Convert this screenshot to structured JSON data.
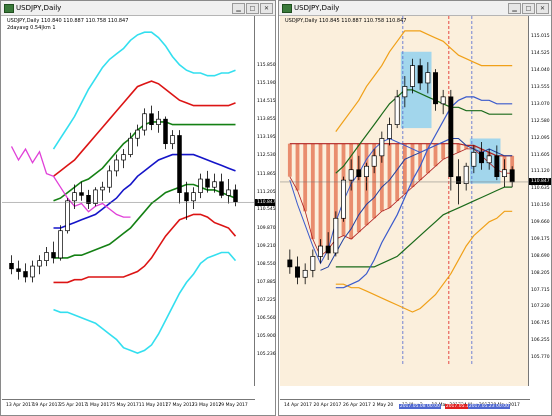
{
  "colors": {
    "candle": "#000000",
    "bb_outer": "#33dfef",
    "bb_mid": "#dc1414",
    "bb_inner": "#148014",
    "bb_center": "#1414c8",
    "rci": "#e040d8",
    "right_bg": "#fbefdc",
    "ichimoku_cloud": "#e26440",
    "ichimoku_base": "#1a6a1a",
    "ichimoku_conv": "#3a5acc",
    "orange_band": "#f0a018",
    "highlight_box": "#8ccff0",
    "vline_blue": "#5068d0",
    "vline_red": "#e02020",
    "price_marker": "#000000"
  },
  "left_chart": {
    "title": "USDJPY,Daily",
    "info_line1": "USDJPY,Daily  110.840 110.887 110.758 110.847",
    "info_line2": "2dayavg 0.54|km 1",
    "price_labels": [
      "115.850",
      "115.190",
      "114.515",
      "113.855",
      "113.195",
      "112.530",
      "111.865",
      "111.205",
      "110.545",
      "109.870",
      "109.210",
      "108.550",
      "107.885",
      "107.225",
      "106.560",
      "105.900",
      "105.236"
    ],
    "current_price": "110.847",
    "time_labels": [
      "13 Apr 2017",
      "19 Apr 2017",
      "25 Apr 2017",
      "1 May 2017",
      "5 May 2017",
      "11 May 2017",
      "17 May 2017",
      "23 May 2017",
      "29 May 2017"
    ],
    "candles": [
      [
        108.6,
        108.9,
        108.2,
        108.4
      ],
      [
        108.4,
        108.7,
        108.0,
        108.3
      ],
      [
        108.3,
        108.6,
        107.9,
        108.1
      ],
      [
        108.1,
        108.7,
        107.9,
        108.5
      ],
      [
        108.5,
        108.9,
        108.2,
        108.7
      ],
      [
        108.7,
        109.2,
        108.5,
        109.0
      ],
      [
        109.0,
        109.4,
        108.6,
        108.8
      ],
      [
        108.8,
        110.0,
        108.7,
        109.8
      ],
      [
        109.8,
        111.0,
        109.7,
        110.9
      ],
      [
        110.9,
        111.5,
        110.6,
        111.2
      ],
      [
        111.2,
        111.6,
        110.9,
        111.1
      ],
      [
        111.1,
        111.3,
        110.6,
        110.8
      ],
      [
        110.8,
        111.4,
        110.7,
        111.3
      ],
      [
        111.3,
        111.6,
        110.9,
        111.4
      ],
      [
        111.4,
        112.2,
        111.2,
        112.0
      ],
      [
        112.0,
        112.6,
        111.8,
        112.4
      ],
      [
        112.4,
        112.8,
        112.1,
        112.6
      ],
      [
        112.6,
        113.4,
        112.5,
        113.2
      ],
      [
        113.2,
        113.7,
        112.9,
        113.5
      ],
      [
        113.5,
        114.3,
        113.3,
        114.1
      ],
      [
        114.1,
        114.4,
        113.5,
        113.7
      ],
      [
        113.7,
        114.2,
        113.4,
        113.9
      ],
      [
        113.9,
        114.0,
        112.8,
        113.0
      ],
      [
        113.0,
        113.5,
        112.8,
        113.3
      ],
      [
        113.3,
        113.5,
        110.8,
        111.2
      ],
      [
        111.2,
        111.6,
        110.2,
        110.9
      ],
      [
        110.9,
        111.4,
        110.6,
        111.2
      ],
      [
        111.2,
        111.9,
        111.0,
        111.7
      ],
      [
        111.7,
        112.0,
        111.2,
        111.4
      ],
      [
        111.4,
        111.9,
        111.2,
        111.6
      ],
      [
        111.6,
        111.9,
        111.0,
        111.1
      ],
      [
        111.1,
        111.7,
        110.8,
        111.3
      ],
      [
        111.3,
        111.5,
        110.7,
        110.85
      ]
    ],
    "bb_upper3": [
      null,
      null,
      null,
      null,
      null,
      null,
      112.8,
      113.2,
      113.6,
      114.0,
      114.5,
      115.0,
      115.4,
      115.8,
      116.1,
      116.3,
      116.5,
      116.8,
      117.0,
      117.1,
      117.1,
      116.9,
      116.6,
      116.2,
      115.9,
      115.7,
      115.6,
      115.6,
      115.5,
      115.5,
      115.6,
      115.6,
      115.7
    ],
    "bb_upper2": [
      null,
      null,
      null,
      null,
      null,
      null,
      111.8,
      112.0,
      112.2,
      112.4,
      112.7,
      113.0,
      113.3,
      113.6,
      113.9,
      114.2,
      114.5,
      114.8,
      115.1,
      115.2,
      115.3,
      115.2,
      115.0,
      114.8,
      114.6,
      114.5,
      114.4,
      114.4,
      114.4,
      114.4,
      114.4,
      114.4,
      114.5
    ],
    "bb_upper1": [
      null,
      null,
      null,
      null,
      null,
      null,
      110.9,
      111.0,
      111.2,
      111.4,
      111.6,
      111.7,
      111.9,
      112.1,
      112.4,
      112.7,
      113.0,
      113.2,
      113.5,
      113.7,
      113.8,
      113.8,
      113.8,
      113.7,
      113.7,
      113.7,
      113.7,
      113.7,
      113.7,
      113.7,
      113.7,
      113.7,
      113.7
    ],
    "bb_mid": [
      null,
      null,
      null,
      null,
      null,
      null,
      109.9,
      109.9,
      110.0,
      110.1,
      110.2,
      110.3,
      110.4,
      110.6,
      110.8,
      111.0,
      111.3,
      111.5,
      111.8,
      112.0,
      112.2,
      112.4,
      112.5,
      112.6,
      112.6,
      112.6,
      112.6,
      112.5,
      112.4,
      112.3,
      112.2,
      112.1,
      112.0
    ],
    "bb_lower1": [
      null,
      null,
      null,
      null,
      null,
      null,
      108.8,
      108.8,
      108.8,
      108.9,
      108.9,
      109.0,
      109.1,
      109.2,
      109.3,
      109.5,
      109.7,
      109.9,
      110.2,
      110.5,
      110.8,
      111.0,
      111.2,
      111.3,
      111.4,
      111.5,
      111.5,
      111.4,
      111.3,
      111.3,
      111.2,
      111.1,
      111.0
    ],
    "bb_lower2": [
      null,
      null,
      null,
      null,
      null,
      null,
      107.9,
      107.9,
      107.9,
      108.0,
      108.0,
      108.1,
      108.1,
      108.1,
      108.1,
      108.1,
      108.1,
      108.2,
      108.3,
      108.5,
      108.8,
      109.2,
      109.6,
      109.9,
      110.2,
      110.3,
      110.4,
      110.4,
      110.3,
      110.1,
      110.0,
      109.9,
      109.6
    ],
    "bb_lower3": [
      null,
      null,
      null,
      null,
      null,
      null,
      106.9,
      106.8,
      106.8,
      106.7,
      106.6,
      106.5,
      106.4,
      106.2,
      106.0,
      105.8,
      105.5,
      105.4,
      105.3,
      105.4,
      105.6,
      106.0,
      106.5,
      107.0,
      107.5,
      107.9,
      108.2,
      108.6,
      108.8,
      108.9,
      109.0,
      109.0,
      108.7
    ],
    "rci": [
      112.9,
      112.4,
      112.8,
      112.3,
      112.7,
      111.9,
      111.8,
      111.4,
      111.0,
      110.7,
      110.8,
      110.5,
      110.7,
      110.8,
      110.6,
      110.4,
      110.3,
      110.3,
      null,
      null,
      null,
      null,
      null,
      null,
      null,
      null,
      null,
      null,
      null,
      null,
      null,
      null,
      null
    ]
  },
  "right_chart": {
    "title": "USDJPY,Daily",
    "info_line1": "USDJPY,Daily  110.845 110.887 110.758 110.847",
    "price_labels": [
      "115.015",
      "114.525",
      "114.040",
      "113.555",
      "113.070",
      "112.580",
      "112.095",
      "111.605",
      "111.120",
      "110.635",
      "110.150",
      "109.660",
      "109.175",
      "108.690",
      "108.205",
      "107.715",
      "107.230",
      "106.745",
      "106.255",
      "105.770"
    ],
    "current_price": "110.847",
    "time_labels": [
      "14 Apr 2017",
      "20 Apr 2017",
      "26 Apr 2017",
      "2 May 20",
      "12 May 2",
      "18 May 2017",
      "24 May 2017",
      "30 May 2017"
    ],
    "time_badges": [
      {
        "text": "2017.05.08 00:00",
        "color": "#5068d0"
      },
      {
        "text": "2017.05.1",
        "color": "#e02020"
      },
      {
        "text": "2017.05.23 00:00",
        "color": "#5068d0"
      }
    ],
    "candles": [
      [
        108.6,
        108.9,
        108.2,
        108.4
      ],
      [
        108.4,
        108.7,
        107.9,
        108.1
      ],
      [
        108.1,
        108.5,
        107.9,
        108.3
      ],
      [
        108.3,
        108.9,
        108.1,
        108.7
      ],
      [
        108.7,
        109.2,
        108.5,
        109.0
      ],
      [
        109.0,
        109.4,
        108.6,
        108.8
      ],
      [
        108.8,
        110.0,
        108.7,
        109.8
      ],
      [
        109.8,
        111.0,
        109.7,
        110.9
      ],
      [
        110.9,
        111.5,
        110.6,
        111.2
      ],
      [
        111.2,
        111.6,
        110.9,
        111.0
      ],
      [
        111.0,
        111.4,
        110.6,
        111.3
      ],
      [
        111.3,
        111.8,
        111.1,
        111.6
      ],
      [
        111.6,
        112.3,
        111.4,
        112.1
      ],
      [
        112.1,
        112.7,
        111.9,
        112.5
      ],
      [
        112.5,
        113.5,
        112.4,
        113.3
      ],
      [
        113.3,
        113.9,
        113.0,
        113.6
      ],
      [
        113.6,
        114.4,
        113.4,
        114.2
      ],
      [
        114.2,
        114.4,
        113.5,
        113.7
      ],
      [
        113.7,
        114.3,
        113.4,
        114.0
      ],
      [
        114.0,
        114.1,
        112.9,
        113.1
      ],
      [
        113.1,
        113.5,
        112.8,
        113.3
      ],
      [
        113.3,
        113.5,
        110.6,
        111.0
      ],
      [
        111.0,
        111.5,
        110.2,
        110.8
      ],
      [
        110.8,
        111.4,
        110.6,
        111.3
      ],
      [
        111.3,
        111.9,
        111.1,
        111.7
      ],
      [
        111.7,
        112.0,
        111.2,
        111.4
      ],
      [
        111.4,
        111.8,
        111.2,
        111.6
      ],
      [
        111.6,
        111.9,
        110.9,
        111.0
      ],
      [
        111.0,
        111.5,
        110.7,
        111.2
      ],
      [
        111.2,
        111.3,
        110.7,
        110.85
      ]
    ],
    "kijun": [
      null,
      null,
      null,
      null,
      null,
      null,
      107.8,
      107.8,
      107.9,
      108.0,
      108.2,
      108.6,
      109.1,
      109.5,
      109.9,
      110.4,
      110.9,
      111.3,
      111.8,
      112.2,
      112.6,
      113.0,
      113.2,
      113.3,
      113.3,
      113.2,
      113.2,
      113.1,
      113.1,
      113.1
    ],
    "tenkan": [
      null,
      null,
      null,
      null,
      108.3,
      108.4,
      108.8,
      109.2,
      109.5,
      109.9,
      110.2,
      110.4,
      110.7,
      110.9,
      111.2,
      111.5,
      111.6,
      111.7,
      111.8,
      111.9,
      112.0,
      112.1,
      112.1,
      111.9,
      111.8,
      111.7,
      111.8,
      111.7,
      111.6,
      111.6
    ],
    "chikou": [
      110.9,
      110.2,
      109.6,
      109.0,
      108.5,
      108.9,
      109.7,
      110.3,
      110.8,
      111.1,
      111.5,
      111.8,
      112.0,
      112.1,
      112.0,
      111.9,
      111.8,
      111.7,
      111.8,
      111.9,
      112.0,
      112.1
    ],
    "senkou_a": [
      111.95,
      111.95,
      111.95,
      111.95,
      111.95,
      111.95,
      111.95,
      111.95,
      111.95,
      111.95,
      111.95,
      111.95,
      111.95,
      111.95,
      111.95,
      111.95,
      111.95,
      111.95,
      111.95,
      111.95,
      111.95,
      111.95,
      111.95,
      111.9,
      111.9,
      111.8,
      111.7,
      111.6,
      111.6,
      111.6
    ],
    "senkou_b": [
      111.0,
      110.6,
      110.0,
      109.2,
      108.7,
      108.9,
      109.2,
      109.3,
      109.2,
      109.4,
      109.6,
      109.8,
      110.0,
      110.1,
      110.3,
      110.5,
      110.7,
      110.9,
      111.1,
      111.3,
      111.5,
      111.6,
      111.7,
      111.8,
      111.8,
      111.6,
      111.4,
      111.2,
      111.1,
      111.1
    ],
    "orange_upper": [
      null,
      null,
      null,
      null,
      null,
      null,
      112.3,
      112.6,
      112.9,
      113.2,
      113.6,
      113.9,
      114.2,
      114.6,
      114.9,
      115.2,
      115.2,
      115.2,
      115.1,
      115.0,
      114.9,
      114.7,
      114.5,
      114.4,
      114.3,
      114.2,
      114.2,
      114.2,
      114.2,
      114.2
    ],
    "orange_lower": [
      null,
      null,
      null,
      null,
      null,
      null,
      107.9,
      107.9,
      107.8,
      107.8,
      107.7,
      107.6,
      107.5,
      107.4,
      107.3,
      107.2,
      107.1,
      107.2,
      107.4,
      107.6,
      107.9,
      108.2,
      108.6,
      109.0,
      109.3,
      109.5,
      109.7,
      109.8,
      110.0,
      110.0
    ],
    "green_upper": [
      null,
      null,
      null,
      null,
      null,
      null,
      111.1,
      111.3,
      111.6,
      111.9,
      112.2,
      112.5,
      112.8,
      113.1,
      113.3,
      113.5,
      113.5,
      113.4,
      113.3,
      113.2,
      113.1,
      113.0,
      113.0,
      112.9,
      112.9,
      112.9,
      112.8,
      112.8,
      112.8,
      112.8
    ],
    "green_lower": [
      null,
      null,
      null,
      null,
      null,
      null,
      108.4,
      108.4,
      108.4,
      108.4,
      108.4,
      108.4,
      108.5,
      108.6,
      108.7,
      108.9,
      109.1,
      109.3,
      109.5,
      109.7,
      109.9,
      110.0,
      110.1,
      110.2,
      110.3,
      110.4,
      110.5,
      110.6,
      110.7,
      110.7
    ]
  }
}
